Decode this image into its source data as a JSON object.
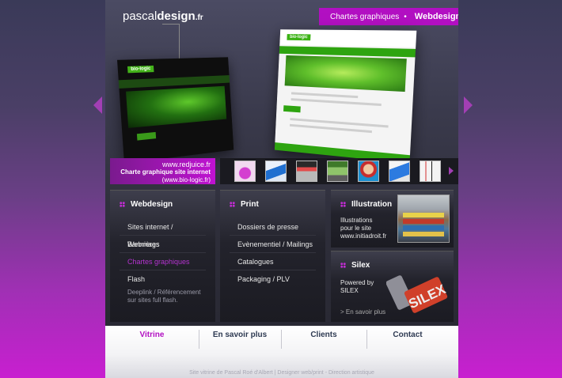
{
  "header": {
    "logo_part1": "pascal",
    "logo_part2": "design",
    "logo_part3": ".fr",
    "breadcrumb_parent": "Chartes graphiques",
    "breadcrumb_sep": "•",
    "breadcrumb_current": "Webdesign"
  },
  "mockups": {
    "brand_tag": "bio-logic"
  },
  "showcase": {
    "url": "www.redjuice.fr",
    "title": "Charte graphique site internet",
    "subtitle": "(www.bio-logic.fr)"
  },
  "thumbnails": [
    {
      "icon": "purple-drop-icon"
    },
    {
      "icon": "blue-banner-icon"
    },
    {
      "icon": "webpage-icon"
    },
    {
      "icon": "green-site-icon"
    },
    {
      "icon": "character-icon"
    },
    {
      "icon": "blue-folder-icon"
    },
    {
      "icon": "cards-icon"
    }
  ],
  "webdesign": {
    "title": "Webdesign",
    "items": [
      "Sites internet / Webmags",
      "Bannières",
      "Chartes graphiques",
      "Flash"
    ],
    "active_index": 2,
    "note": "Deeplink / Référencement sur sites full flash."
  },
  "print": {
    "title": "Print",
    "items": [
      "Dossiers de presse",
      "Evènementiel / Mailings",
      "Catalogues",
      "Packaging / PLV"
    ]
  },
  "illustration": {
    "title": "Illustration",
    "line1": "Illustrations",
    "line2": "pour le site",
    "line3": "www.initiadroit.fr"
  },
  "silex": {
    "title": "Silex",
    "line1": "Powered by",
    "line2": "SILEX",
    "more": "> En savoir plus",
    "logo_text": "SILEX"
  },
  "nav": {
    "items": [
      "Vitrine",
      "En savoir plus",
      "Clients",
      "Contact"
    ],
    "active_index": 0
  },
  "footer": {
    "credits": "Site vitrine de Pascal Roé d'Albert  |  Designer web/print - Direction artistique"
  },
  "colors": {
    "accent": "#b20fc2",
    "panel": "#23232c",
    "nav_text": "#2e3a52"
  }
}
